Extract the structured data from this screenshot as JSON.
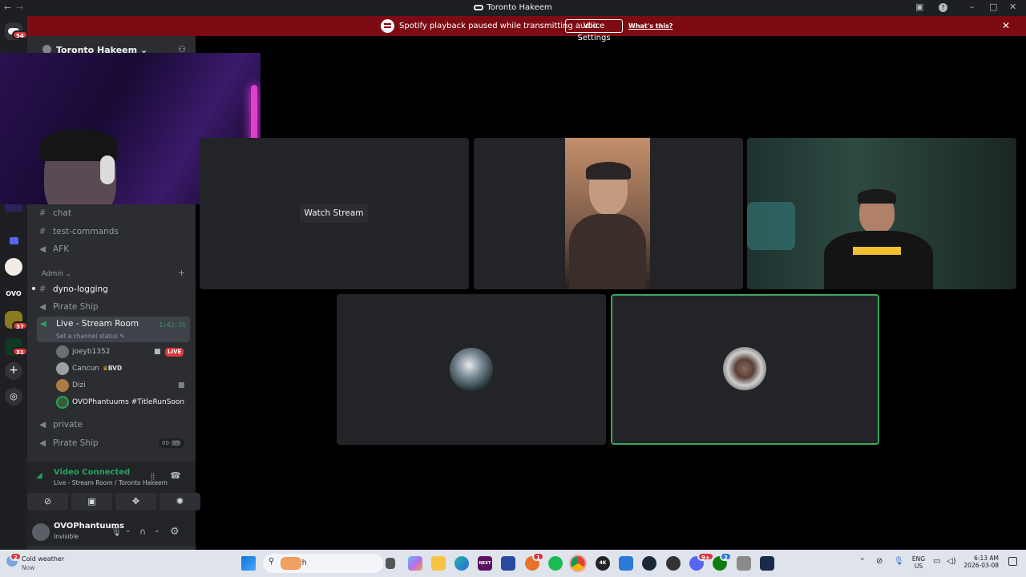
{
  "titlebar": {
    "title": "Toronto Hakeem"
  },
  "banner": {
    "message": "Spotify playback paused while transmitting audio.",
    "button": "Voice Settings",
    "link": "What's this?"
  },
  "rail": {
    "badges": [
      "54",
      "37",
      "31"
    ],
    "server_text": [
      "OVO"
    ]
  },
  "sidebar": {
    "server_name": "Toronto Hakeem",
    "channels_top": [
      {
        "name": "chat",
        "icon": "#"
      },
      {
        "name": "test-commands",
        "icon": "#"
      },
      {
        "name": "AFK",
        "icon": "speaker"
      }
    ],
    "category": "Admin",
    "channels_admin": [
      {
        "name": "dyno-logging",
        "icon": "#"
      },
      {
        "name": "Pirate Ship",
        "icon": "speaker"
      }
    ],
    "live_channel": {
      "name": "Live - Stream Room",
      "timer": "1:42:31",
      "status": "Set a channel status"
    },
    "members": [
      {
        "name": "joeyb1352",
        "badge": "LIVE"
      },
      {
        "name": "Cancun",
        "tag": "BVD"
      },
      {
        "name": "Dizi"
      },
      {
        "name": "OVOPhantuums #TitleRunSoon"
      }
    ],
    "channels_bottom": [
      {
        "name": "private",
        "icon": "speaker"
      },
      {
        "name": "Pirate Ship",
        "icon": "speaker",
        "count_left": "00",
        "count_right": "99"
      }
    ]
  },
  "voice": {
    "status": "Video Connected",
    "sub": "Live - Stream Room / Toronto Hakeem"
  },
  "user": {
    "name": "OVOPhantuums",
    "status": "Invisible"
  },
  "stage": {
    "watch_button": "Watch Stream"
  },
  "taskbar": {
    "weather_badge": "2",
    "weather": "Cold weather",
    "weather_sub": "Now",
    "search": "Search",
    "lang": "ENG",
    "region": "US",
    "time": "6:13 AM",
    "date": "2026-03-08",
    "app_badges": [
      "1",
      "9+",
      "2"
    ],
    "app_labels": [
      "NEXT",
      "4K"
    ]
  },
  "colors": {
    "banner": "#7d0b14",
    "live_red": "#da373c",
    "connected_green": "#23a559",
    "speaking_border": "#3ba55c"
  }
}
